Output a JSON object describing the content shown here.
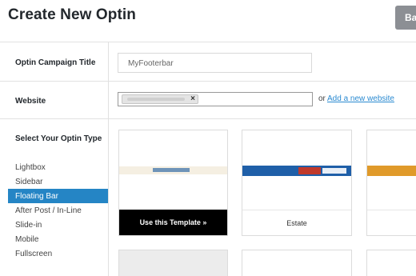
{
  "page": {
    "title": "Create New Optin",
    "back_label": "Bac"
  },
  "campaign": {
    "label": "Optin Campaign Title",
    "value": "MyFooterbar"
  },
  "website": {
    "label": "Website",
    "remove_icon": "×",
    "or_text": "or",
    "add_link": "Add a new website"
  },
  "optin_type": {
    "label": "Select Your Optin Type",
    "items": [
      "Lightbox",
      "Sidebar",
      "Floating Bar",
      "After Post / In-Line",
      "Slide-in",
      "Mobile",
      "Fullscreen"
    ],
    "selected": "Floating Bar"
  },
  "templates": {
    "use_template_label": "Use this Template »",
    "estate_label": "Estate"
  },
  "colors": {
    "accent": "#2585c5",
    "link": "#2a8ad1",
    "dark_footer": "#000000",
    "orange_bar": "#e09a2a",
    "blue_bar": "#1f5fa8",
    "red_button": "#c0392b"
  }
}
